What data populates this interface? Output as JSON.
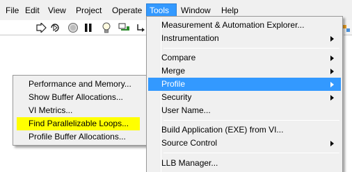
{
  "menubar": {
    "items": [
      {
        "label": "File"
      },
      {
        "label": "Edit"
      },
      {
        "label": "View"
      },
      {
        "label": "Project"
      },
      {
        "label": "Operate"
      },
      {
        "label": "Tools"
      },
      {
        "label": "Window"
      },
      {
        "label": "Help"
      }
    ],
    "active": "Tools",
    "active_color": "#3399ff"
  },
  "toolbar": {
    "icons": [
      "run-arrow-icon",
      "run-continuously-icon",
      "abort-icon",
      "pause-icon",
      "highlight-bulb-icon",
      "retain-wire-values-icon",
      "step-into-icon",
      "clean-diagram-icon"
    ],
    "pause_glyph": "❚❚",
    "bulb_glyph": "💡"
  },
  "tools_menu": {
    "items": [
      {
        "label": "Measurement & Automation Explorer...",
        "submenu": false
      },
      {
        "label": "Instrumentation",
        "submenu": true
      },
      {
        "label": "Compare",
        "submenu": true
      },
      {
        "label": "Merge",
        "submenu": true
      },
      {
        "label": "Profile",
        "submenu": true,
        "selected": true
      },
      {
        "label": "Security",
        "submenu": true
      },
      {
        "label": "User Name...",
        "submenu": false
      },
      {
        "label": "Build Application (EXE) from VI...",
        "submenu": false
      },
      {
        "label": "Source Control",
        "submenu": true
      },
      {
        "label": "LLB Manager...",
        "submenu": false
      }
    ]
  },
  "profile_submenu": {
    "items": [
      {
        "label": "Performance and Memory..."
      },
      {
        "label": "Show Buffer Allocations..."
      },
      {
        "label": "VI Metrics..."
      },
      {
        "label": "Find Parallelizable Loops...",
        "highlighted": true
      },
      {
        "label": "Profile Buffer Allocations..."
      }
    ],
    "highlight_color": "#ffff00"
  }
}
